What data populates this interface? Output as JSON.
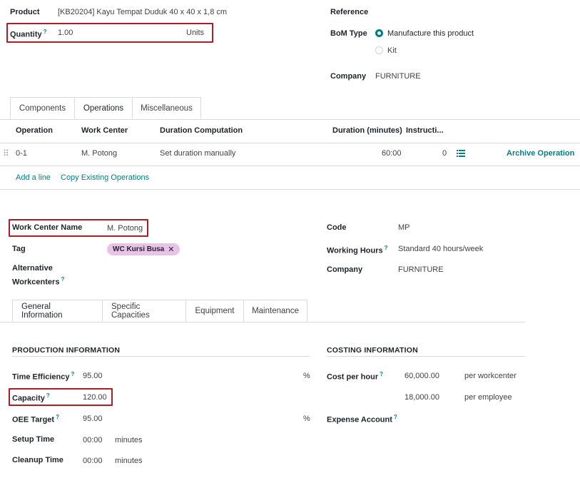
{
  "bom": {
    "product_label": "Product",
    "product_value": "[KB20204] Kayu Tempat Duduk 40 x 40 x 1,8 cm",
    "quantity_label": "Quantity",
    "quantity_value": "1.00",
    "quantity_uom": "Units",
    "reference_label": "Reference",
    "bom_type_label": "BoM Type",
    "bom_type_options": [
      "Manufacture this product",
      "Kit"
    ],
    "company_label": "Company",
    "company_value": "FURNITURE",
    "tabs": [
      "Components",
      "Operations",
      "Miscellaneous"
    ],
    "active_tab": "Operations"
  },
  "operations_table": {
    "headers": [
      "Operation",
      "Work Center",
      "Duration Computation",
      "Duration (minutes)",
      "Instructi..."
    ],
    "rows": [
      {
        "operation": "0-1",
        "work_center": "M. Potong",
        "duration_computation": "Set duration manually",
        "duration": "60:00",
        "instructions": "0",
        "action": "Archive Operation"
      }
    ],
    "add_line": "Add a line",
    "copy_ops": "Copy Existing Operations"
  },
  "workcenter": {
    "name_label": "Work Center Name",
    "name_value": "M. Potong",
    "tag_label": "Tag",
    "tag_value": "WC Kursi Busa",
    "alt_label_1": "Alternative",
    "alt_label_2": "Workcenters",
    "code_label": "Code",
    "code_value": "MP",
    "hours_label": "Working Hours",
    "hours_value": "Standard 40 hours/week",
    "company_label": "Company",
    "company_value": "FURNITURE",
    "tabs": [
      "General Information",
      "Specific Capacities",
      "Equipment",
      "Maintenance"
    ],
    "active_tab": "General Information",
    "production": {
      "title": "PRODUCTION INFORMATION",
      "time_eff_label": "Time Efficiency",
      "time_eff_value": "95.00",
      "capacity_label": "Capacity",
      "capacity_value": "120.00",
      "oee_label": "OEE Target",
      "oee_value": "95.00",
      "setup_label": "Setup Time",
      "setup_value": "00:00",
      "cleanup_label": "Cleanup Time",
      "cleanup_value": "00:00",
      "minutes": "minutes",
      "percent": "%"
    },
    "costing": {
      "title": "COSTING INFORMATION",
      "cost_label": "Cost per hour",
      "cost_wc_value": "60,000.00",
      "cost_wc_unit": "per workcenter",
      "cost_emp_value": "18,000.00",
      "cost_emp_unit": "per employee",
      "expense_label": "Expense Account"
    }
  },
  "colors": {
    "accent": "#017e84",
    "highlight_box": "#b01c2a",
    "tag_pill": "#e9c3e7"
  }
}
